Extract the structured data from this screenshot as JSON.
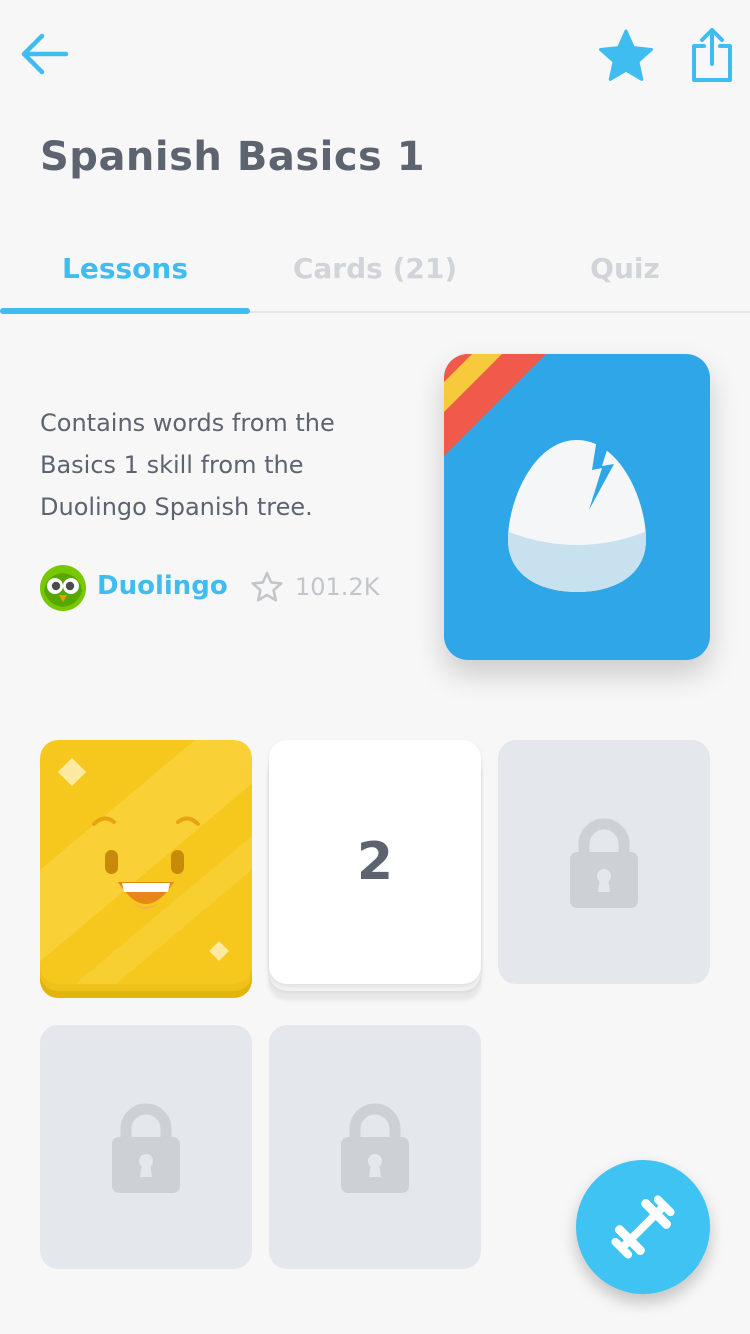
{
  "header": {
    "title": "Spanish Basics 1"
  },
  "tabs": [
    {
      "label": "Lessons"
    },
    {
      "label": "Cards (21)"
    },
    {
      "label": "Quiz"
    }
  ],
  "deck": {
    "description": "Contains words from the Basics 1 skill from the Duolingo Spanish tree.",
    "author": "Duolingo",
    "rating_count": "101.2K"
  },
  "lessons": [
    {
      "state": "completed",
      "label": ""
    },
    {
      "state": "current",
      "label": "2"
    },
    {
      "state": "locked",
      "label": ""
    },
    {
      "state": "locked",
      "label": ""
    },
    {
      "state": "locked",
      "label": ""
    }
  ],
  "icons": {
    "back": "back-arrow-icon",
    "favorite": "star-icon",
    "share": "share-icon",
    "rating": "star-outline-icon",
    "lock": "lock-icon",
    "practice": "dumbbell-icon"
  },
  "colors": {
    "accent": "#3fbdf0",
    "text": "#5d6470",
    "deck_cover": "#2ea6e8",
    "completed_card": "#f6c81e",
    "locked_card": "#e4e7eb"
  }
}
